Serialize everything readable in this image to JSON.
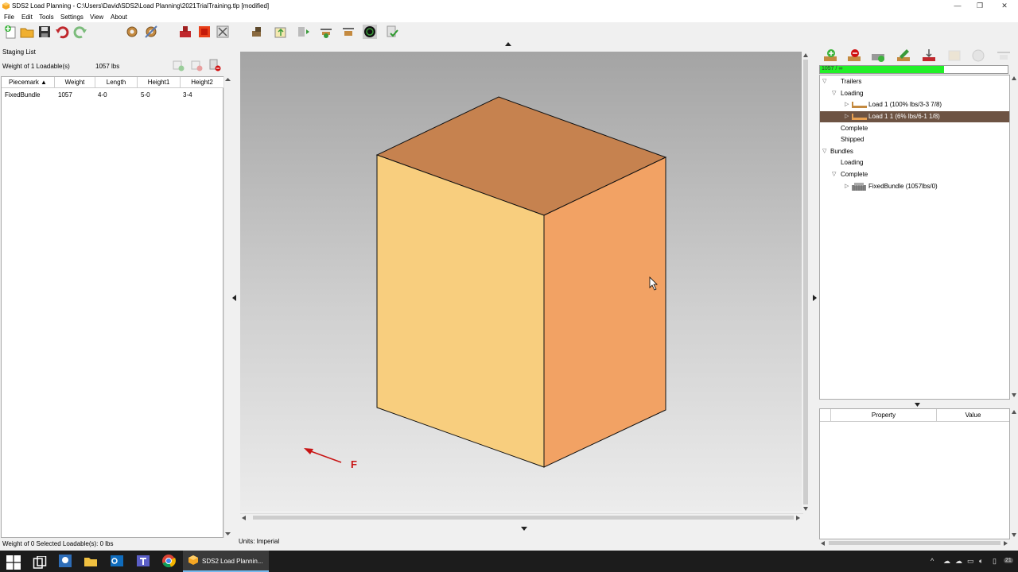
{
  "window": {
    "title": "SDS2 Load Planning - C:\\Users\\David\\SDS2\\Load Planning\\2021TrialTraining.tlp [modified]",
    "minimize_glyph": "—",
    "maximize_glyph": "❐",
    "close_glyph": "✕"
  },
  "menu": [
    "File",
    "Edit",
    "Tools",
    "Settings",
    "View",
    "About"
  ],
  "toolbar_icons": [
    "new-icon",
    "open-folder-icon",
    "save-icon",
    "undo-icon",
    "redo-icon",
    "settings-gear-icon",
    "settings-gear2-icon",
    "load-icon",
    "stop-icon",
    "close-x-icon",
    "truck-icon",
    "export-icon",
    "lift-icon",
    "crane-icon",
    "crane2-icon",
    "spiral-icon",
    "check-icon"
  ],
  "staging": {
    "title": "Staging List",
    "weight_label": "Weight of 1 Loadable(s)",
    "weight_value": "1057 lbs",
    "columns": [
      "Piecemark",
      "Weight",
      "Length",
      "Height1",
      "Height2"
    ],
    "rows": [
      [
        "FixedBundle",
        "1057",
        "4-0",
        "5-0",
        "3-4"
      ]
    ]
  },
  "viewport": {
    "direction_label": "F",
    "units": "Units: Imperial"
  },
  "status": {
    "left": "Weight of 0 Selected Loadable(s): 0 lbs"
  },
  "progress": {
    "text": "1057 / ∞",
    "fraction": 0.66
  },
  "tree": {
    "trailers": "Trailers",
    "loading": "Loading",
    "load1": "Load 1 (100% lbs/3-3 7/8)",
    "load11": "Load 1 1 (6% lbs/6-1 1/8)",
    "complete": "Complete",
    "shipped": "Shipped",
    "bundles": "Bundles",
    "bundles_loading": "Loading",
    "bundles_complete": "Complete",
    "fixedbundle": "FixedBundle (1057lbs/0)"
  },
  "properties": {
    "columns": [
      "Property",
      "Value"
    ]
  },
  "taskbar": {
    "active_app": "SDS2 Load Plannin...",
    "tray_badge": "21"
  },
  "colors": {
    "cube_top": "#c6824f",
    "cube_left": "#f8ce7e",
    "cube_right": "#f2a264",
    "selection": "#6d5343",
    "progress": "#22f028",
    "arrow": "#c81414"
  }
}
